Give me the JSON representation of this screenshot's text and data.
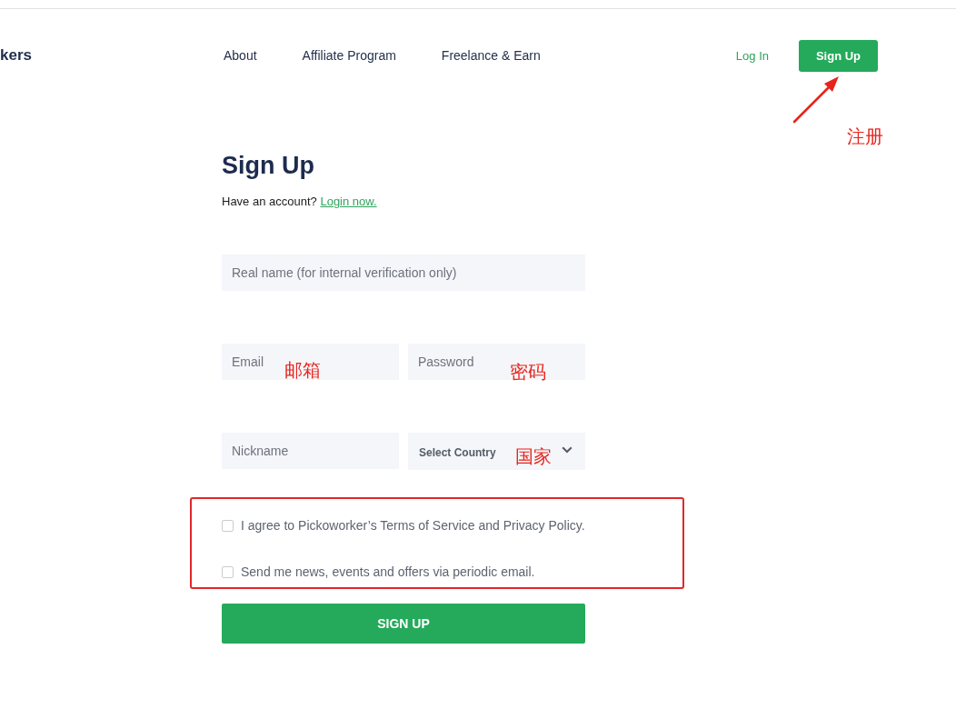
{
  "header": {
    "logo": "kers",
    "nav": [
      {
        "label": "About"
      },
      {
        "label": "Affiliate Program"
      },
      {
        "label": "Freelance & Earn"
      }
    ],
    "login": "Log In",
    "signup": {
      "label": "Sign Up",
      "annotation": "注册"
    }
  },
  "form": {
    "title": "Sign Up",
    "prompt": "Have an account?",
    "login_link": "Login now.",
    "field_rows": [
      [
        {
          "kind": "input",
          "placeholder": "Real name (for internal verification only)"
        }
      ],
      [
        {
          "kind": "input",
          "placeholder": "Email",
          "annotation": "邮箱"
        },
        {
          "kind": "input",
          "placeholder": "Password",
          "annotation": "密码"
        }
      ],
      [
        {
          "kind": "input",
          "placeholder": "Nickname"
        },
        {
          "kind": "select",
          "placeholder": "Select Country",
          "annotation": "国家"
        }
      ]
    ],
    "consent": {
      "highlighted": true,
      "items": [
        {
          "label": "I agree to Pickoworker’s Terms of Service and Privacy Policy.",
          "checked": false
        },
        {
          "label": "Send me news, events and offers via periodic email.",
          "checked": false
        }
      ]
    },
    "submit": "SIGN UP"
  }
}
